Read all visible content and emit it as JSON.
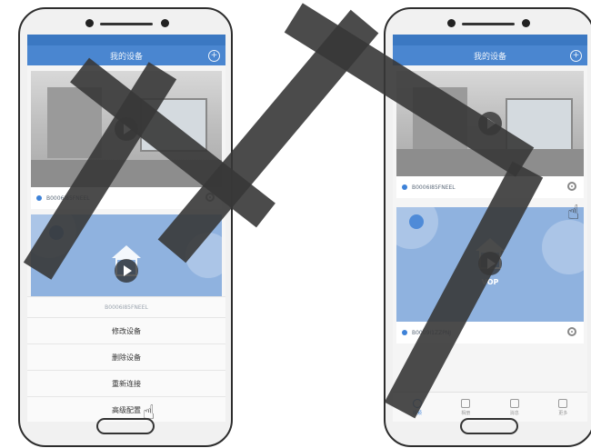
{
  "left_phone": {
    "nav_title": "我的设备",
    "camera_id": "B0006I85FNEEL",
    "sheet": {
      "title": "B0006I85FNEEL",
      "items": [
        "修改设备",
        "删除设备",
        "重新连接",
        "高级配置"
      ]
    }
  },
  "right_phone": {
    "nav_title": "我的设备",
    "camera_id": "B0006I85FNEEL",
    "vop_label": "VOP",
    "vop_id": "B0009I1ZZPNJ",
    "tabs": [
      "视频",
      "相册",
      "消息",
      "更多"
    ]
  },
  "icons": {
    "add": "+",
    "hand": "☝"
  }
}
